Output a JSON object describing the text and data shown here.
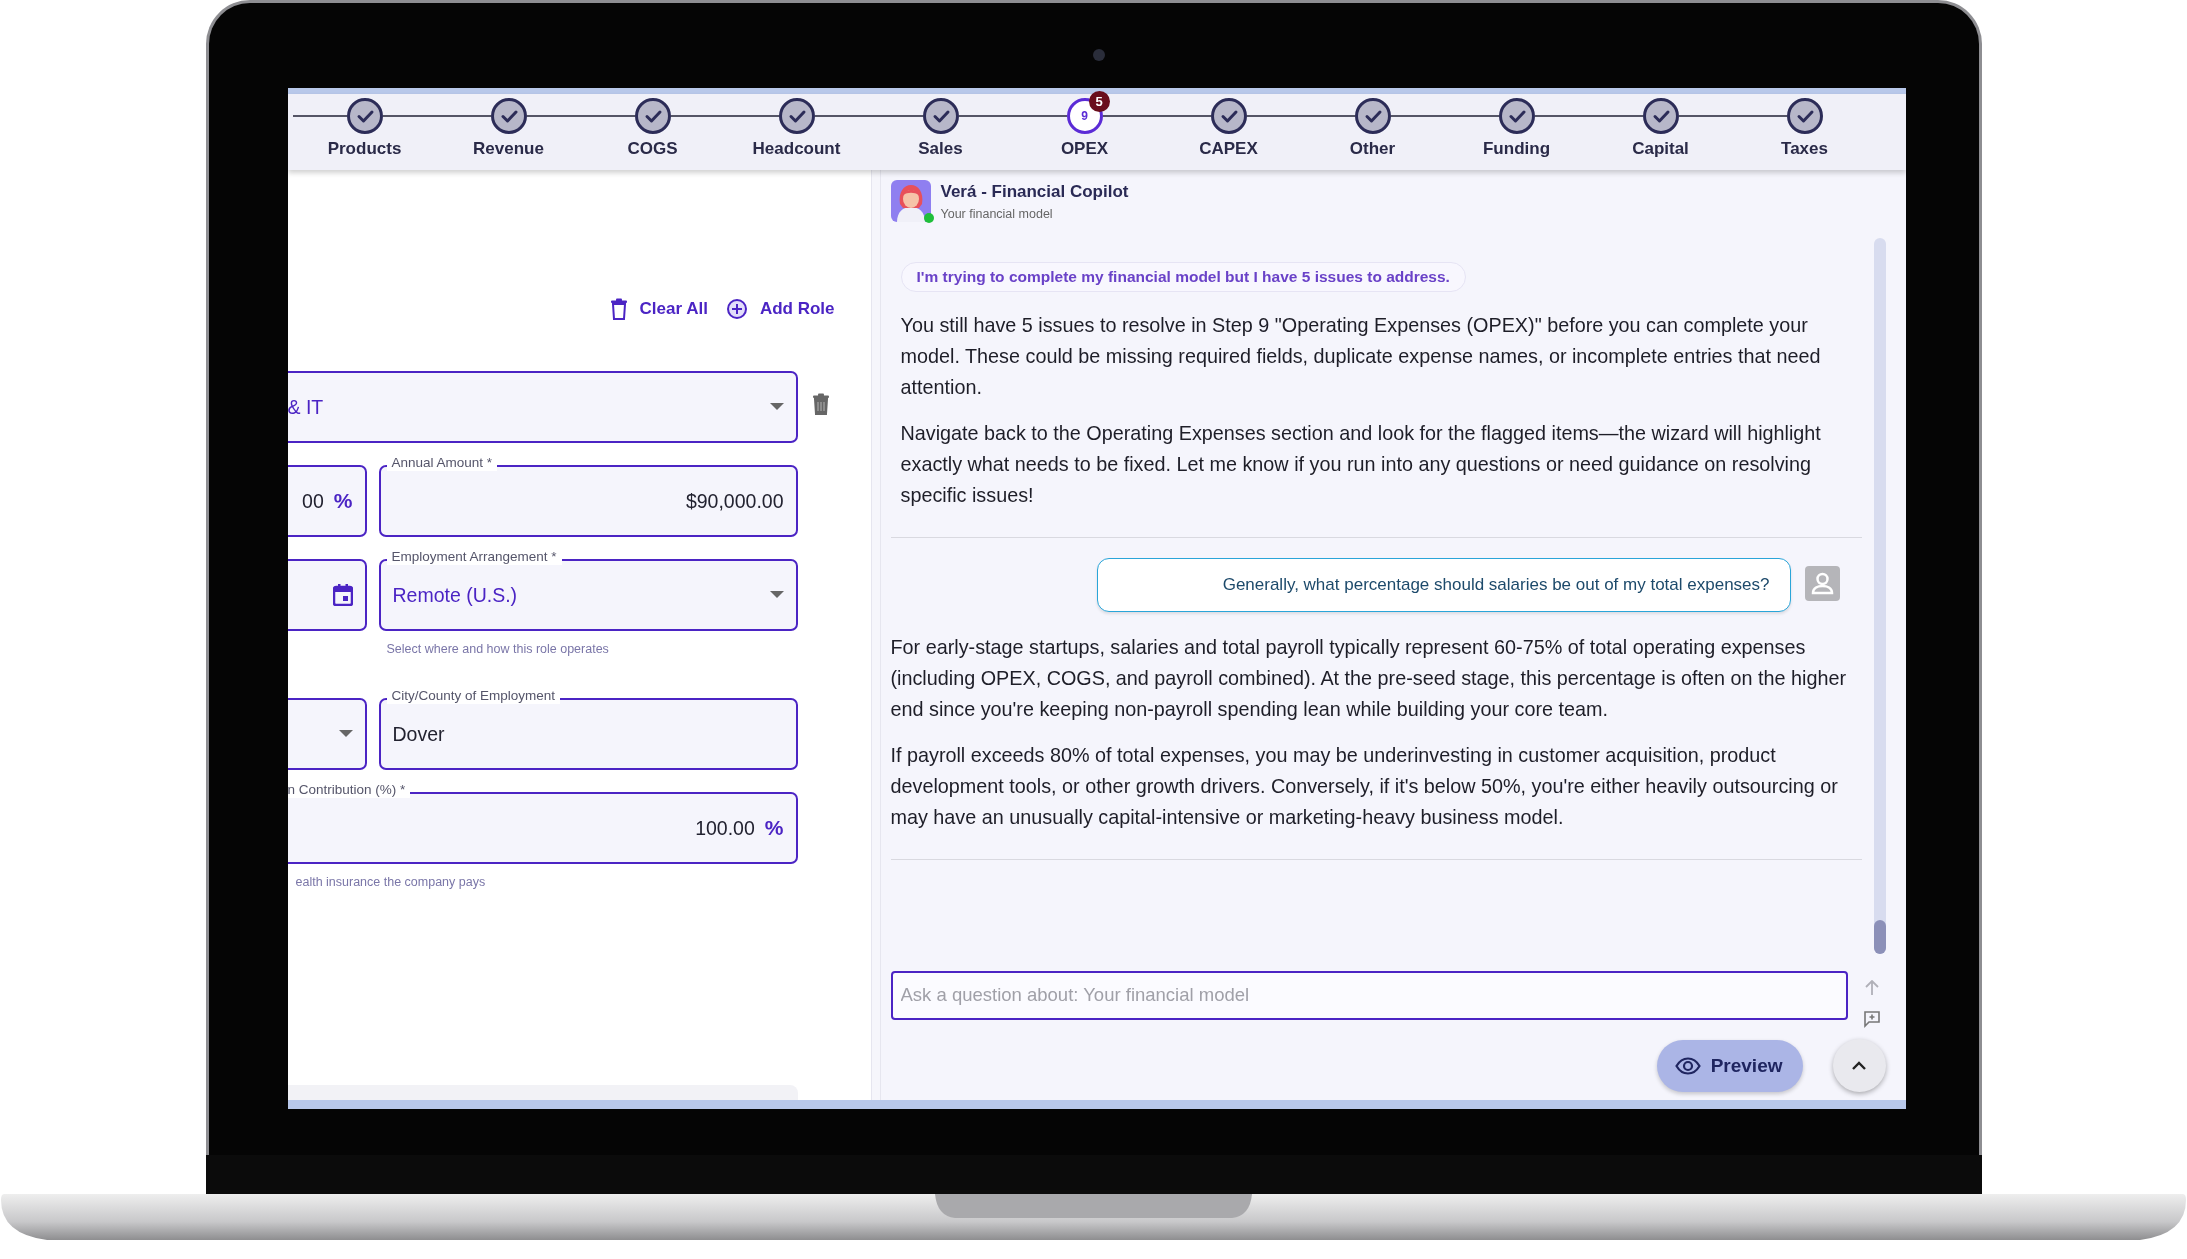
{
  "stepper": {
    "steps": [
      {
        "label": "Products",
        "completed": true
      },
      {
        "label": "Revenue",
        "completed": true
      },
      {
        "label": "COGS",
        "completed": true
      },
      {
        "label": "Headcount",
        "completed": true
      },
      {
        "label": "Sales",
        "completed": true
      },
      {
        "label": "OPEX",
        "completed": false,
        "number": "9",
        "badge": "5"
      },
      {
        "label": "CAPEX",
        "completed": true
      },
      {
        "label": "Other",
        "completed": true
      },
      {
        "label": "Funding",
        "completed": true
      },
      {
        "label": "Capital",
        "completed": true
      },
      {
        "label": "Taxes",
        "completed": true
      }
    ]
  },
  "roles_panel": {
    "actions": [
      {
        "kind": "clear",
        "label": "Clear All"
      },
      {
        "kind": "add",
        "label": "Add Role"
      }
    ],
    "rows": [
      {
        "delete": true,
        "fields": [
          {
            "kind": "select",
            "value": "& IT"
          }
        ]
      },
      {
        "delete": false,
        "fields": [
          {
            "kind": "number",
            "value": "00",
            "suffix": "%"
          },
          {
            "kind": "number",
            "label": "Annual Amount *",
            "value": "$90,000.00"
          }
        ]
      },
      {
        "delete": false,
        "fields": [
          {
            "kind": "date"
          },
          {
            "kind": "select",
            "label": "Employment Arrangement *",
            "value": "Remote (U.S.)",
            "helper": "Select where and how this role operates"
          }
        ]
      },
      {
        "delete": false,
        "fields": [
          {
            "kind": "select"
          },
          {
            "kind": "text",
            "label": "City/County of Employment",
            "value": "Dover"
          }
        ]
      },
      {
        "delete": false,
        "fields": [
          {
            "kind": "number",
            "label": "n Contribution (%) *",
            "value": "100.00",
            "suffix": "%",
            "helper": "ealth insurance the company pays"
          }
        ]
      }
    ]
  },
  "chat": {
    "assistant": {
      "name": "Verá - Financial Copilot",
      "subtitle": "Your financial model",
      "online": true
    },
    "messages": [
      {
        "kind": "prompt",
        "text": "I'm trying to complete my financial model but I have 5 issues to address."
      },
      {
        "kind": "assistant",
        "paragraphs": [
          "You still have 5 issues to resolve in Step 9 \"Operating Expenses (OPEX)\" before you can complete your model. These could be missing required fields, duplicate expense names, or incomplete entries that need attention.",
          "Navigate back to the Operating Expenses section and look for the flagged items—the wizard will highlight exactly what needs to be fixed. Let me know if you run into any questions or need guidance on resolving specific issues!"
        ]
      },
      {
        "kind": "user",
        "text": "Generally, what percentage should salaries be out of my total expenses?"
      },
      {
        "kind": "assistant",
        "paragraphs": [
          "For early-stage startups, salaries and total payroll typically represent 60-75% of total operating expenses (including OPEX, COGS, and payroll combined). At the pre-seed stage, this percentage is often on the higher end since you're keeping non-payroll spending lean while building your core team.",
          "If payroll exceeds 80% of total expenses, you may be underinvesting in customer acquisition, product development tools, or other growth drivers. Conversely, if it's below 50%, you're either heavily outsourcing or may have an unusually capital-intensive or marketing-heavy business model."
        ]
      }
    ],
    "input": {
      "placeholder": "Ask a question about: Your financial model"
    },
    "preview_button": "Preview"
  }
}
